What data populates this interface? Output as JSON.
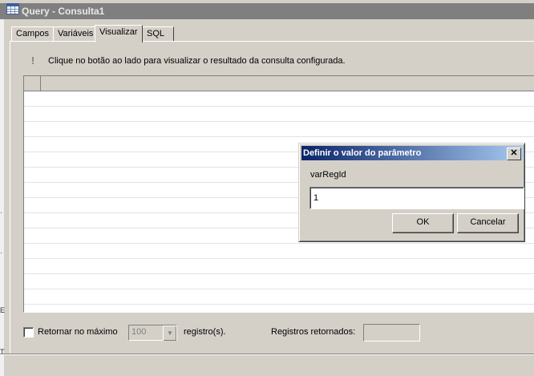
{
  "window": {
    "title": "Query - Consulta1"
  },
  "tabs": [
    {
      "label": "Campos"
    },
    {
      "label": "Variáveis"
    },
    {
      "label": "Visualizar"
    },
    {
      "label": "SQL"
    }
  ],
  "active_tab": "Visualizar",
  "info": {
    "icon": "exclamation-icon",
    "text": "Clique no botão ao lado para visualizar o resultado da consulta configurada."
  },
  "grid": {
    "rows": []
  },
  "options": {
    "limit_label": "Retornar no máximo",
    "limit_checked": false,
    "limit_value": "100",
    "records_suffix": "registro(s).",
    "returned_label": "Registros retornados:",
    "returned_value": ""
  },
  "dialog": {
    "title": "Definir o valor do parâmetro",
    "param_name": "varRegId",
    "param_value": "1",
    "ok_label": "OK",
    "cancel_label": "Cancelar",
    "close_icon": "close-icon"
  },
  "colors": {
    "face": "#d4d0c8",
    "dialog_title_start": "#0a246a",
    "dialog_title_end": "#a6caf0",
    "inactive_title": "#7f7f7f"
  }
}
